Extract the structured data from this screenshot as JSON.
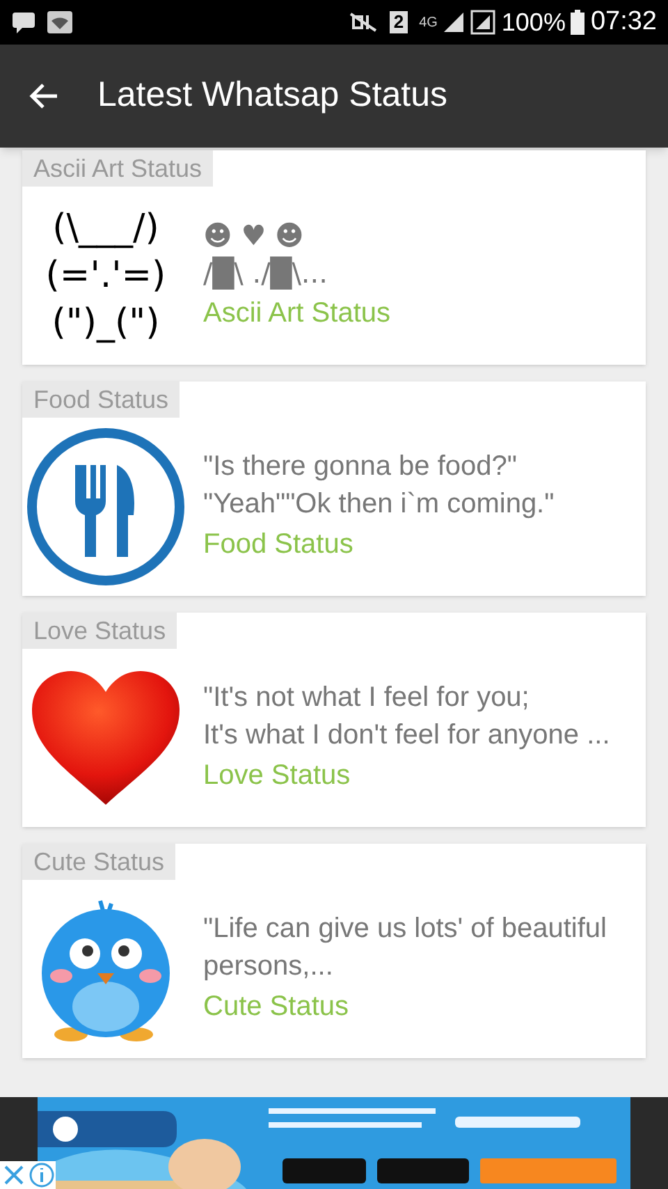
{
  "status_bar": {
    "sim": "2",
    "network": "4G",
    "battery": "100%",
    "time": "07:32"
  },
  "app_bar": {
    "title": "Latest Whatsap Status"
  },
  "cards": [
    {
      "kind": "ascii",
      "category": "Ascii Art Status",
      "art_lines": [
        "(\\___/)",
        "(='.'=)",
        "(\")_(\")"
      ],
      "preview_lines": [
        "☻ ♥ ☻",
        "/█\\ ./█\\..."
      ],
      "link": "Ascii Art Status"
    },
    {
      "kind": "food",
      "category": "Food Status",
      "preview_lines": [
        "\"Is there gonna be food?\"",
        "\"Yeah\"\"Ok then i`m coming.\""
      ],
      "link": "Food Status"
    },
    {
      "kind": "love",
      "category": "Love Status",
      "preview_lines": [
        "\"It's not what I feel for you;",
        "It's what I don't feel for anyone ..."
      ],
      "link": "Love Status"
    },
    {
      "kind": "cute",
      "category": "Cute Status",
      "preview_lines": [
        "\"Life can give us lots' of beautiful persons,..."
      ],
      "link": "Cute Status"
    }
  ]
}
